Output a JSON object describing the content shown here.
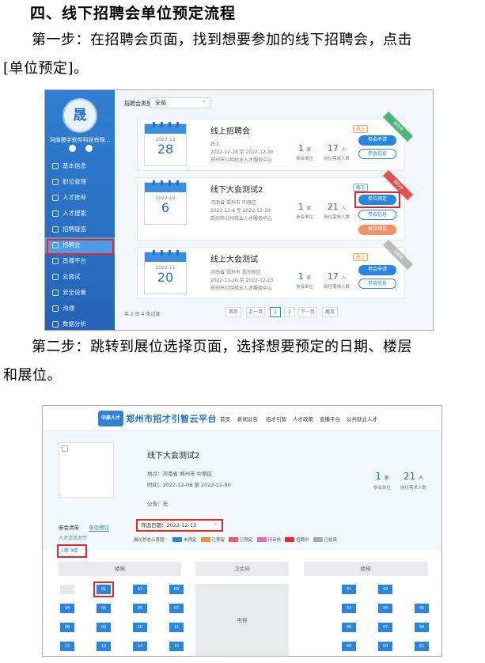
{
  "doc": {
    "heading": "四、线下招聘会单位预定流程",
    "step1_line1": "第一步：在招聘会页面，找到想要参加的线下招聘会，点击",
    "step1_line2": "[单位预定]。",
    "step2_line1": "第二步：跳转到展位选择页面，选择想要预定的日期、楼层",
    "step2_line2": "和展位。"
  },
  "shot1": {
    "logo_text": "晟",
    "company": "河南晟宇软件科技有限...",
    "menu": [
      {
        "label": "基本信息"
      },
      {
        "label": "职位管理"
      },
      {
        "label": "人才推荐"
      },
      {
        "label": "人才搜索"
      },
      {
        "label": "招聘疑惑"
      },
      {
        "label": "招聘会"
      },
      {
        "label": "直播平台"
      },
      {
        "label": "云面试"
      },
      {
        "label": "安全设置"
      },
      {
        "label": "沟通"
      },
      {
        "label": "数据分析"
      }
    ],
    "filter_label": "招聘会类型",
    "filter_value": "全部",
    "cards": [
      {
        "ym": "2022-12",
        "day": "28",
        "title": "线上招聘会",
        "tag": "线上",
        "place": "线上",
        "time": "2022-12-28 至 2022-12-30",
        "org": "郑州市公共就业人才服务中心",
        "units": "1",
        "units_unit": "家",
        "units_label": "参会单位",
        "needs": "17",
        "needs_unit": "人",
        "needs_label": "岗位需求人数",
        "btn1": "参会申请",
        "btn2": "参会信息",
        "ribbon": "进行中"
      },
      {
        "ym": "2022-12",
        "day": "6",
        "title": "线下大会测试2",
        "tag": "线下",
        "place": "河南省 郑州市 中原区",
        "time": "2022-12-6 至 2022-12-30",
        "org": "郑州市公共就业人才服务中心",
        "units": "1",
        "units_unit": "家",
        "units_label": "参会单位",
        "needs": "21",
        "needs_unit": "人",
        "needs_label": "岗位需求人数",
        "btn1": "单位预定",
        "btn2": "参会信息",
        "btn3": "展位预览",
        "ribbon": "预约中"
      },
      {
        "ym": "2022-11",
        "day": "20",
        "title": "线上大会测试",
        "tag": "线上",
        "place": "河南省 郑州市 郑东新区",
        "time": "2022-11-20 至 2022-12-10",
        "org": "郑州市公共就业人才服务中心",
        "units": "1",
        "units_unit": "家",
        "units_label": "参会单位",
        "needs": "17",
        "needs_unit": "人",
        "needs_label": "岗位需求人数",
        "btn1": "参会申请",
        "btn2": "参会信息",
        "ribbon": "已结束"
      }
    ],
    "pager": {
      "summary": "共 2 页 4 条记录",
      "first": "首页",
      "prev": "上一页",
      "p1": "1",
      "p2": "2",
      "next": "下一页",
      "last": "尾页"
    }
  },
  "shot2": {
    "logo_text": "中原人才",
    "brand": "郑州市招才引智云平台",
    "nav": [
      "首页",
      "新闻公告",
      "招才引智",
      "人才政策",
      "直播平台",
      "公共就业人才"
    ],
    "title": "线下大会测试2",
    "address": "地点：河南省 郑州市 中原区",
    "time": "时间：2022-12-06 至 2022-12-30",
    "notice": "公告：无",
    "units": "1",
    "units_unit": "家",
    "units_label": "参会单位",
    "needs": "21",
    "needs_unit": "人",
    "needs_label": "岗位需求人数",
    "tab1": "参会清单",
    "tab2": "单位预订",
    "date_label": "筛选日期：",
    "date_value": "2022-12-13",
    "sub_link": "人才交流大厅",
    "legend_title": "展位状态示意图：",
    "legend": [
      {
        "label": "未预定",
        "color": "#2a86dd"
      },
      {
        "label": "已预留",
        "color": "#f08c3a"
      },
      {
        "label": "已预定",
        "color": "#f25b66"
      },
      {
        "label": "待审核",
        "color": "#e86bb3"
      },
      {
        "label": "招聘中",
        "color": "#e8272b"
      },
      {
        "label": "已结束",
        "color": "#aaaaaa"
      }
    ],
    "floors": "1楼    4楼",
    "zones": {
      "left": "楼梯",
      "mid": "卫生间",
      "right": "楼梯"
    },
    "elevator": "电梯",
    "left_booths": [
      [
        "",
        "01",
        "02",
        "03"
      ],
      [
        "04",
        "05",
        "06",
        "07"
      ],
      [
        "08",
        "09",
        "10",
        "11"
      ],
      [
        "12",
        "13",
        "14",
        "15"
      ]
    ],
    "right_booths": [
      [
        "41",
        "42",
        ""
      ],
      [
        "43",
        "44",
        "45"
      ],
      [
        "46",
        "47",
        "48"
      ],
      [
        "49",
        "50",
        "51"
      ]
    ]
  }
}
